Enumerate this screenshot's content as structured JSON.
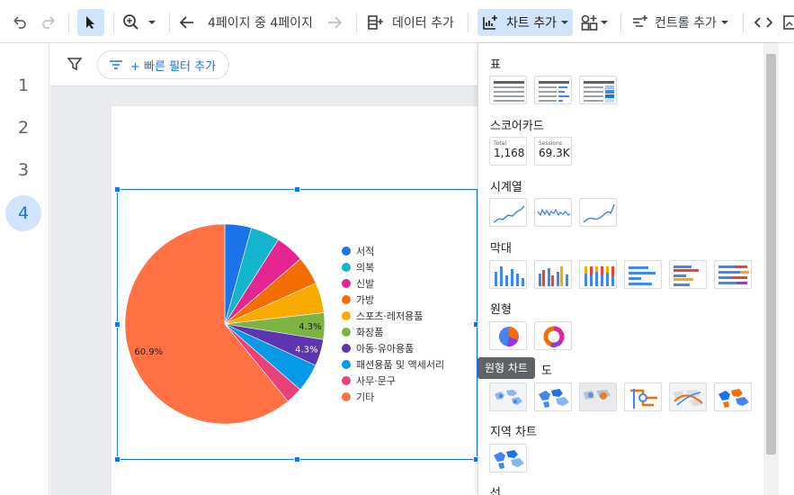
{
  "toolbar": {
    "page_nav_label": "4페이지 중 4페이지",
    "add_data_label": "데이터 추가",
    "add_chart_label": "차트 추가",
    "add_control_label": "컨트롤 추가"
  },
  "filter_bar": {
    "quick_filter_label": "+ 빠른 필터 추가"
  },
  "pages": [
    "1",
    "2",
    "3",
    "4"
  ],
  "active_page": "4",
  "chart_panel": {
    "sections": {
      "table": "표",
      "scorecard": "스코어카드",
      "timeseries": "시계열",
      "bar": "막대",
      "pie": "원형",
      "geo_map_tail": "도",
      "geo_chart": "지역 차트",
      "line": "선"
    },
    "scorecards": [
      {
        "label": "Total",
        "value": "1,168"
      },
      {
        "label": "Sessions",
        "value": "69.3K"
      }
    ],
    "tooltip": "원형 차트"
  },
  "chart_data": {
    "type": "pie",
    "title": "",
    "series": [
      {
        "label": "서적",
        "value": 4.3,
        "color": "#1a73e8"
      },
      {
        "label": "의복",
        "value": 4.7,
        "color": "#12b5cb"
      },
      {
        "label": "신발",
        "value": 4.7,
        "color": "#e52592"
      },
      {
        "label": "가방",
        "value": 4.6,
        "color": "#f46d03"
      },
      {
        "label": "스포츠·레저용품",
        "value": 4.9,
        "color": "#f9ab00"
      },
      {
        "label": "화장품",
        "value": 4.3,
        "color": "#7cb342"
      },
      {
        "label": "아동·유아용품",
        "value": 4.3,
        "color": "#5e35b1"
      },
      {
        "label": "패션용품 및 액세서리",
        "value": 4.6,
        "color": "#039be5"
      },
      {
        "label": "사무·문구",
        "value": 2.7,
        "color": "#ec407a"
      },
      {
        "label": "기타",
        "value": 60.9,
        "color": "#ff7043"
      }
    ],
    "data_labels": [
      "4.3%",
      "4.3%",
      "60.9%"
    ]
  }
}
